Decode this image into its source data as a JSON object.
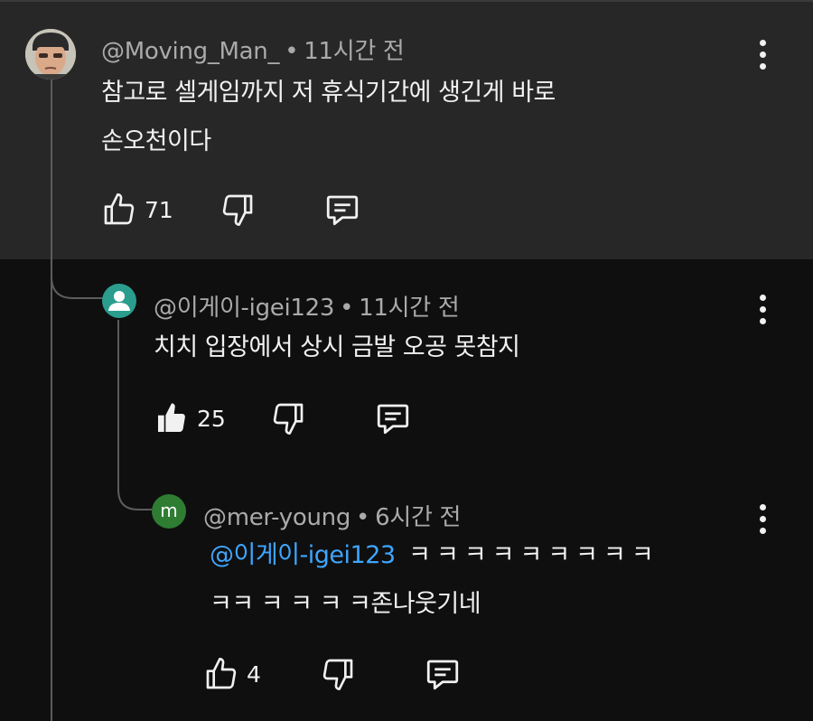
{
  "colors": {
    "background": "#0f0f0f",
    "highlight_panel": "#272727",
    "text_primary": "#f1f1f1",
    "text_secondary": "#aaaaaa",
    "mention": "#3ea6ff",
    "avatar_teal": "#2a9d8f",
    "avatar_green": "#2e7d32"
  },
  "comments": [
    {
      "author": "@Moving_Man_",
      "separator": "•",
      "time": "11시간 전",
      "lines": [
        "참고로 셀게임까지 저 휴식기간에 생긴게 바로",
        "손오천이다"
      ],
      "likes": "71",
      "avatar_icon": "profile-photo",
      "like_icon": "thumb-up-outline-icon",
      "dislike_icon": "thumb-down-outline-icon",
      "reply_icon": "comment-reply-icon",
      "menu_icon": "more-vert-icon"
    },
    {
      "author": "@이게이-igei123",
      "separator": "•",
      "time": "11시간 전",
      "lines": [
        "치치 입장에서 상시 금발 오공 못참지"
      ],
      "likes": "25",
      "avatar_icon": "default-person-avatar",
      "like_icon": "thumb-up-filled-icon",
      "dislike_icon": "thumb-down-outline-icon",
      "reply_icon": "comment-reply-icon",
      "menu_icon": "more-vert-icon"
    },
    {
      "author": "@mer-young",
      "separator": "•",
      "time": "6시간 전",
      "avatar_letter": "m",
      "mention": "@이게이-igei123",
      "line1_rest": " ㅋㅋㅋㅋㅋㅋㅋㅋㅋ",
      "line2": "ㅋㅋ ㅋ ㅋ ㅋ ㅋ존나웃기네",
      "likes": "4",
      "like_icon": "thumb-up-outline-icon",
      "dislike_icon": "thumb-down-outline-icon",
      "reply_icon": "comment-reply-icon",
      "menu_icon": "more-vert-icon"
    }
  ]
}
